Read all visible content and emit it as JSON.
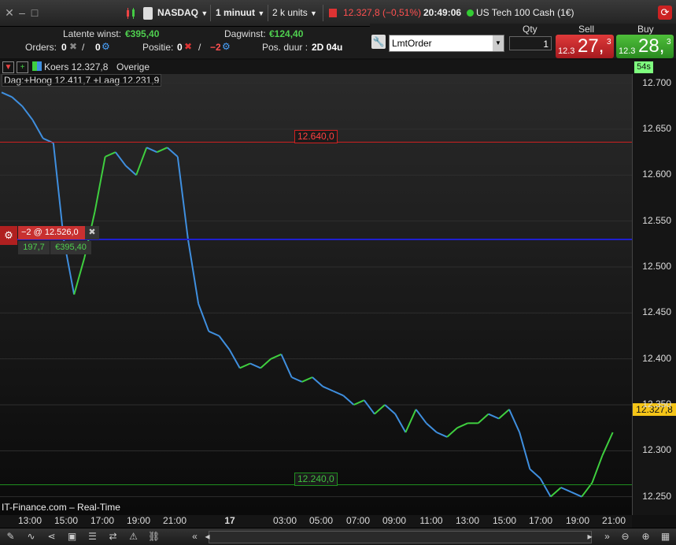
{
  "topbar": {
    "market": "NASDAQ",
    "timeframe": "1 minuut",
    "units": "2 k units",
    "price_change": "12.327,8 (−0,51%)",
    "time": "20:49:06",
    "instrument": "US Tech 100 Cash (1€)"
  },
  "info": {
    "latent_label": "Latente winst:",
    "latent_value": "€395,40",
    "dagwinst_label": "Dagwinst:",
    "dagwinst_value": "€124,40",
    "orders_label": "Orders:",
    "orders_a": "0",
    "orders_b": "0",
    "positie_label": "Positie:",
    "positie_a": "0",
    "positie_b": "−2",
    "duur_label": "Pos. duur :",
    "duur_value": "2D 04u"
  },
  "order": {
    "type": "LmtOrder",
    "qty_label": "Qty",
    "qty": "1",
    "sell_label": "Sell",
    "sell_prefix": "12.3",
    "sell_big": "27,",
    "sell_sup": "3",
    "buy_label": "Buy",
    "buy_prefix": "12.3",
    "buy_big": "28,",
    "buy_sup": "3"
  },
  "chart_head": {
    "series": "Koers 12.327,8",
    "overige": "Overige",
    "day_range": "Dag:+Hoog 12.411,7 +Laag 12.231,9",
    "countdown": "54s"
  },
  "position": {
    "label": "−2 @ 12.526,0",
    "points": "197,7",
    "pnl": "€395,40"
  },
  "levels": {
    "upper": "12.640,0",
    "lower": "12.240,0",
    "current": "12.327,8"
  },
  "watermark": "IT-Finance.com – Real-Time",
  "colors": {
    "up": "#3fcf3f",
    "down": "#3f8fdf",
    "sell": "#c8242b",
    "buy": "#2f8f2f",
    "position_line": "#1f1fcf",
    "upper_line": "#cf2020",
    "lower_line": "#1f8f1f"
  },
  "chart_data": {
    "type": "line",
    "ylim": [
      12230,
      12710
    ],
    "yticks": [
      "12.700",
      "12.650",
      "12.600",
      "12.550",
      "12.500",
      "12.450",
      "12.400",
      "12.350",
      "12.300",
      "12.250"
    ],
    "xticks": [
      "13:00",
      "15:00",
      "17:00",
      "19:00",
      "21:00",
      "17",
      "03:00",
      "05:00",
      "07:00",
      "09:00",
      "11:00",
      "13:00",
      "15:00",
      "17:00",
      "19:00",
      "21:00"
    ],
    "series": [
      {
        "values": [
          12690,
          12685,
          12675,
          12660,
          12640,
          12635,
          12530,
          12470,
          12510,
          12560,
          12620,
          12625,
          12610,
          12600,
          12630,
          12625,
          12630,
          12620,
          12530,
          12460,
          12430,
          12425,
          12410,
          12390,
          12395,
          12390,
          12400,
          12405,
          12380,
          12375,
          12380,
          12370,
          12365,
          12360,
          12350,
          12355,
          12340,
          12350,
          12340,
          12320,
          12345,
          12330,
          12320,
          12315,
          12325,
          12330,
          12330,
          12340,
          12335,
          12345,
          12320,
          12280,
          12270,
          12250,
          12260,
          12255,
          12250,
          12265,
          12295,
          12320
        ]
      }
    ]
  },
  "bottombar": {
    "icons": [
      "pencil-icon",
      "chart-icon",
      "share-icon",
      "window-icon",
      "list-icon",
      "trade-icon",
      "alert-icon",
      "link-icon"
    ]
  }
}
